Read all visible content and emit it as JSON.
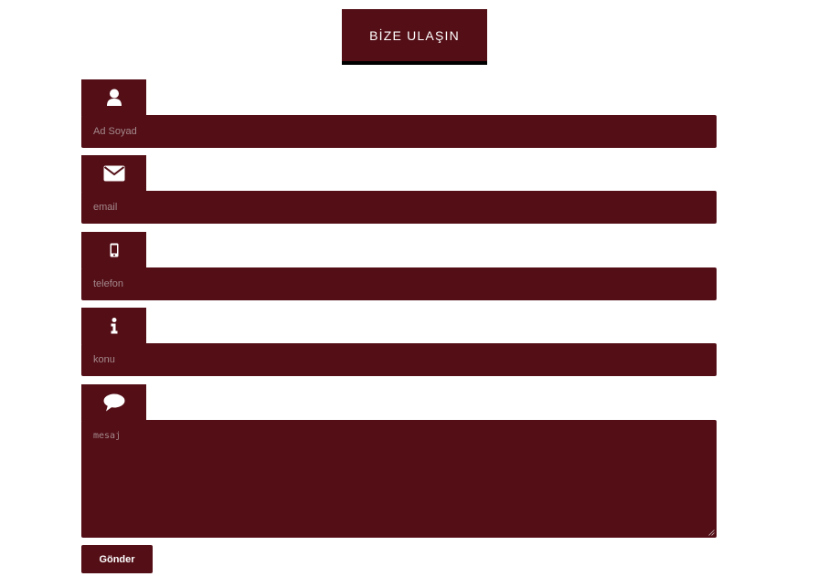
{
  "colors": {
    "accent": "#530e16",
    "placeholder": "#a48a8d",
    "title_border": "#000000",
    "text_light": "#ffffff"
  },
  "header": {
    "title": "BİZE ULAŞIN"
  },
  "form": {
    "fields": [
      {
        "icon": "user-icon",
        "placeholder": "Ad Soyad"
      },
      {
        "icon": "envelope-icon",
        "placeholder": "email"
      },
      {
        "icon": "mobile-phone-icon",
        "placeholder": "telefon"
      },
      {
        "icon": "info-icon",
        "placeholder": "konu"
      }
    ],
    "message": {
      "icon": "comment-icon",
      "placeholder": "mesaj"
    },
    "submit_label": "Gönder"
  }
}
